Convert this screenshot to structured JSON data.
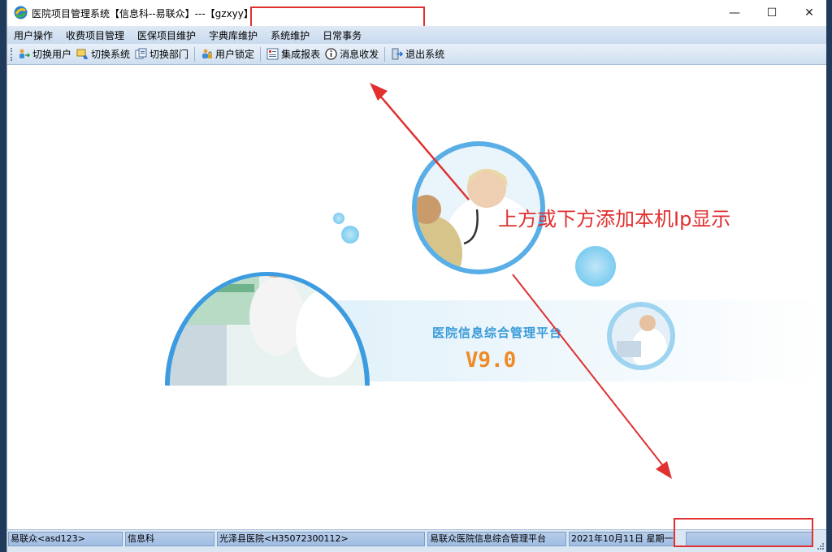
{
  "window": {
    "title": "医院项目管理系统【信息科--易联众】---【gzxyy】",
    "controls": {
      "minimize": "—",
      "maximize": "☐",
      "close": "✕"
    }
  },
  "menu": {
    "items": [
      "用户操作",
      "收费项目管理",
      "医保项目维护",
      "字典库维护",
      "系统维护",
      "日常事务"
    ]
  },
  "toolbar": {
    "buttons": [
      {
        "label": "切换用户",
        "icon": "switch-user-icon"
      },
      {
        "label": "切换系统",
        "icon": "switch-system-icon"
      },
      {
        "label": "切换部门",
        "icon": "switch-department-icon"
      },
      {
        "label": "用户锁定",
        "icon": "user-lock-icon"
      },
      {
        "label": "集成报表",
        "icon": "report-icon"
      },
      {
        "label": "消息收发",
        "icon": "info-icon"
      },
      {
        "label": "退出系统",
        "icon": "exit-icon"
      }
    ]
  },
  "banner": {
    "platform_name": "医院信息综合管理平台",
    "version": "V9.0",
    "annotation": "上方或下方添加本机Ip显示"
  },
  "statusbar": {
    "user": "易联众<asd123>",
    "department": "信息科",
    "hospital": "光泽县医院<H35072300112>",
    "platform": "易联众医院信息综合管理平台",
    "date": "2021年10月11日  星期一",
    "ip": ""
  },
  "colors": {
    "annotation_red": "#e03030",
    "banner_blue": "#3a9ad9",
    "version_orange": "#f08a24"
  }
}
